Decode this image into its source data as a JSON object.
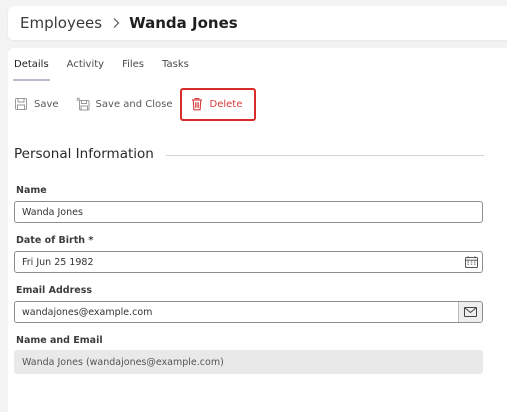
{
  "breadcrumb": {
    "parent": "Employees",
    "current": "Wanda Jones"
  },
  "tabs": [
    {
      "label": "Details",
      "active": true
    },
    {
      "label": "Activity",
      "active": false
    },
    {
      "label": "Files",
      "active": false
    },
    {
      "label": "Tasks",
      "active": false
    }
  ],
  "toolbar": {
    "save_label": "Save",
    "save_close_label": "Save and Close",
    "delete_label": "Delete",
    "delete_color": "#d73b3b",
    "delete_outline_color": "#d82b2b"
  },
  "section": {
    "title": "Personal Information"
  },
  "fields": {
    "name": {
      "label": "Name",
      "value": "Wanda Jones"
    },
    "dob": {
      "label": "Date of Birth *",
      "value": "Fri Jun 25 1982",
      "icon": "calendar-icon"
    },
    "email": {
      "label": "Email Address",
      "value": "wandajones@example.com",
      "icon": "envelope-icon"
    },
    "name_email": {
      "label": "Name and Email",
      "value": "Wanda Jones (wandajones@example.com)"
    }
  }
}
